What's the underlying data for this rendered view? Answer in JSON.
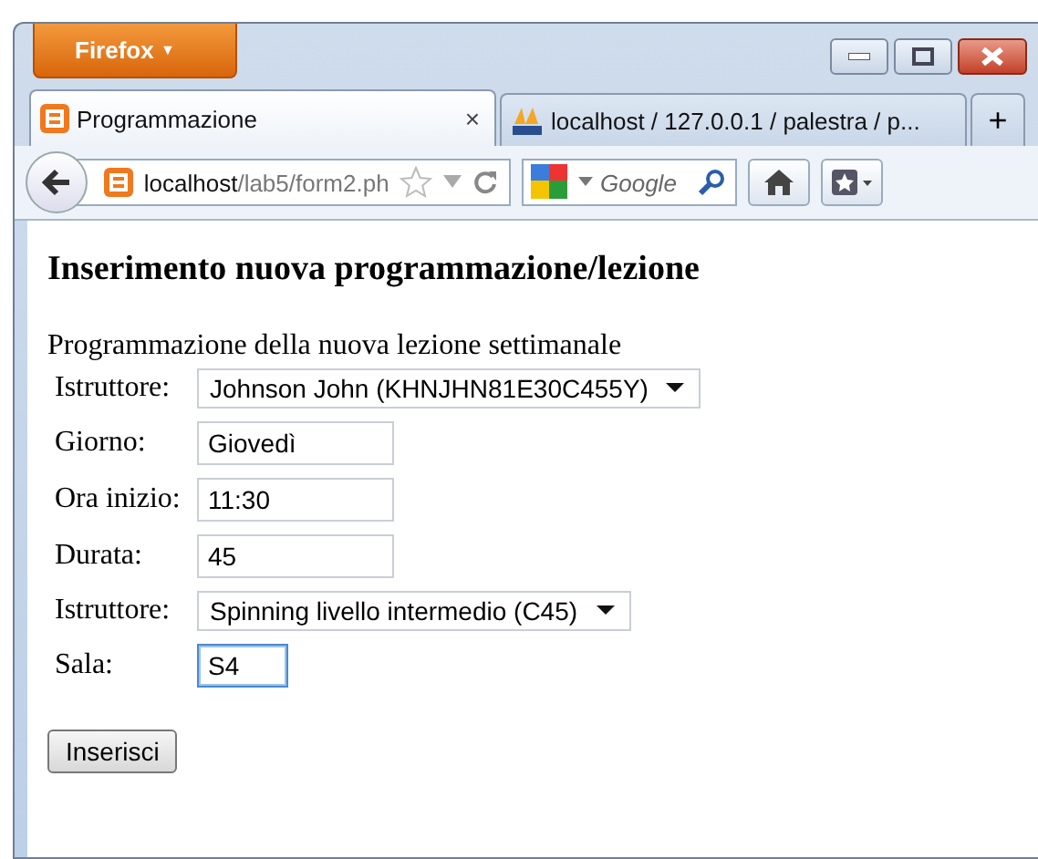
{
  "browser_button": {
    "label": "Firefox",
    "caret": "▼"
  },
  "tabs": [
    {
      "label": "Programmazione",
      "selected": true,
      "close": "×"
    },
    {
      "label": "localhost / 127.0.0.1 / palestra / p...",
      "selected": false
    }
  ],
  "new_tab": "+",
  "address": {
    "host": "localhost",
    "path": "/lab5/form2.ph"
  },
  "search": {
    "placeholder": "Google"
  },
  "page": {
    "title": "Inserimento nuova programmazione/lezione",
    "subtitle": "Programmazione della nuova lezione settimanale",
    "fields": [
      {
        "label": "Istruttore:",
        "kind": "select",
        "value": "Johnson John (KHNJHN81E30C455Y)",
        "focused": false
      },
      {
        "label": "Giorno:",
        "kind": "text",
        "value": "Giovedì",
        "focused": false
      },
      {
        "label": "Ora inizio:",
        "kind": "text",
        "value": "11:30",
        "focused": false
      },
      {
        "label": "Durata:",
        "kind": "text",
        "value": "45",
        "focused": false
      },
      {
        "label": "Istruttore:",
        "kind": "select",
        "value": "Spinning livello intermedio (C45)",
        "focused": false
      },
      {
        "label": "Sala:",
        "kind": "short",
        "value": "S4",
        "focused": true
      }
    ],
    "submit": "Inserisci"
  }
}
